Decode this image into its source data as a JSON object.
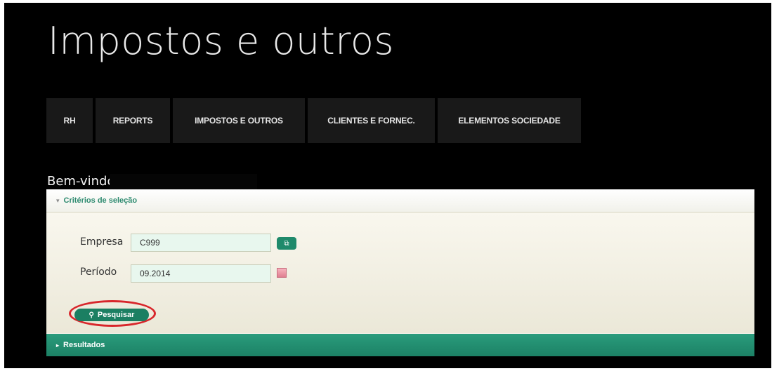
{
  "page": {
    "title": "Impostos e outros",
    "welcome": "Bem-vindo"
  },
  "nav": {
    "items": [
      {
        "label": "RH"
      },
      {
        "label": "REPORTS"
      },
      {
        "label": "IMPOSTOS E OUTROS"
      },
      {
        "label": "CLIENTES E FORNEC."
      },
      {
        "label": "ELEMENTOS SOCIEDADE"
      }
    ]
  },
  "selection": {
    "header": "Critérios de seleção",
    "empresa_label": "Empresa",
    "empresa_value": "C999",
    "periodo_label": "Período",
    "periodo_value": "09.2014",
    "search_label": "Pesquisar"
  },
  "results": {
    "header": "Resultados"
  },
  "icons": {
    "collapse": "chevron-down-icon",
    "expand": "chevron-right-icon",
    "value_help": "value-help-icon",
    "calendar": "calendar-icon",
    "search": "search-icon"
  },
  "colors": {
    "background": "#000000",
    "nav_tile": "#191919",
    "accent_green": "#1f8a6b",
    "highlight_red": "#d8262b"
  }
}
